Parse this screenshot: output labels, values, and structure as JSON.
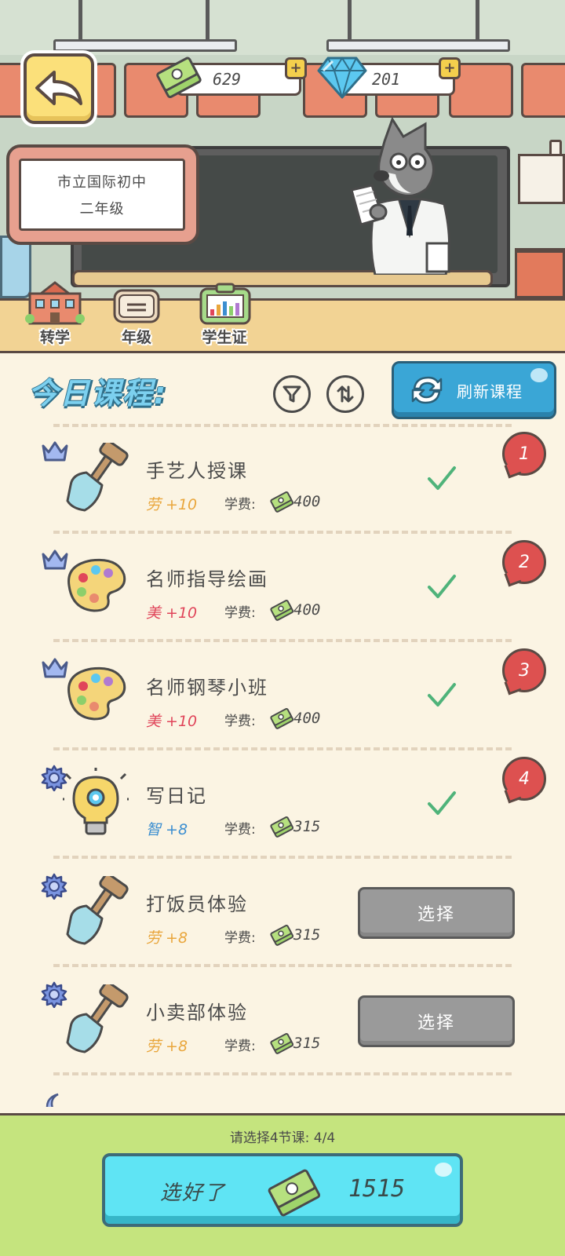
{
  "header": {
    "back_icon": "back-arrow-icon",
    "cash": {
      "icon": "cash-stack-icon",
      "value": "629",
      "plus": "+"
    },
    "gems": {
      "icon": "diamond-icon",
      "value": "201",
      "plus": "+"
    }
  },
  "school": {
    "line1": "市立国际初中",
    "line2": "二年级"
  },
  "toolbar": [
    {
      "label": "转学",
      "icon": "school-building-icon"
    },
    {
      "label": "年级",
      "icon": "grade-book-icon"
    },
    {
      "label": "学生证",
      "icon": "student-card-icon"
    }
  ],
  "courses_header": {
    "title": "今日课程:",
    "filter_icon": "filter-icon",
    "sort_icon": "sort-icon",
    "refresh_label": "刷新课程",
    "refresh_icon": "refresh-icon"
  },
  "fee_label": "学费:",
  "courses": [
    {
      "tier": "crown",
      "icon": "shovel-icon",
      "name": "手艺人授课",
      "stat": "劳 +10",
      "stat_kind": "labor",
      "fee": "400",
      "selected": true,
      "order": "1"
    },
    {
      "tier": "crown",
      "icon": "paint-palette-icon",
      "name": "名师指导绘画",
      "stat": "美 +10",
      "stat_kind": "beauty",
      "fee": "400",
      "selected": true,
      "order": "2"
    },
    {
      "tier": "crown",
      "icon": "paint-palette-icon",
      "name": "名师钢琴小班",
      "stat": "美 +10",
      "stat_kind": "beauty",
      "fee": "400",
      "selected": true,
      "order": "3"
    },
    {
      "tier": "gear",
      "icon": "lightbulb-icon",
      "name": "写日记",
      "stat": "智 +8",
      "stat_kind": "wisdom",
      "fee": "315",
      "selected": true,
      "order": "4"
    },
    {
      "tier": "gear",
      "icon": "shovel-icon",
      "name": "打饭员体验",
      "stat": "劳 +8",
      "stat_kind": "labor",
      "fee": "315",
      "selected": false,
      "button": "选择"
    },
    {
      "tier": "gear",
      "icon": "shovel-icon",
      "name": "小卖部体验",
      "stat": "劳 +8",
      "stat_kind": "labor",
      "fee": "315",
      "selected": false,
      "button": "选择"
    }
  ],
  "footer": {
    "hint": "请选择4节课: 4/4",
    "confirm_label": "选好了",
    "total": "1515",
    "cash_icon": "cash-stack-icon"
  },
  "colors": {
    "labor": "#e9a63c",
    "beauty": "#e0455a",
    "wisdom": "#3b8ed0",
    "check": "#4fb37a",
    "order_badge": "#dd5150",
    "refresh_button": "#3aa6d6",
    "confirm_button": "#5fe4f4",
    "footer_bg": "#c5e47e"
  }
}
